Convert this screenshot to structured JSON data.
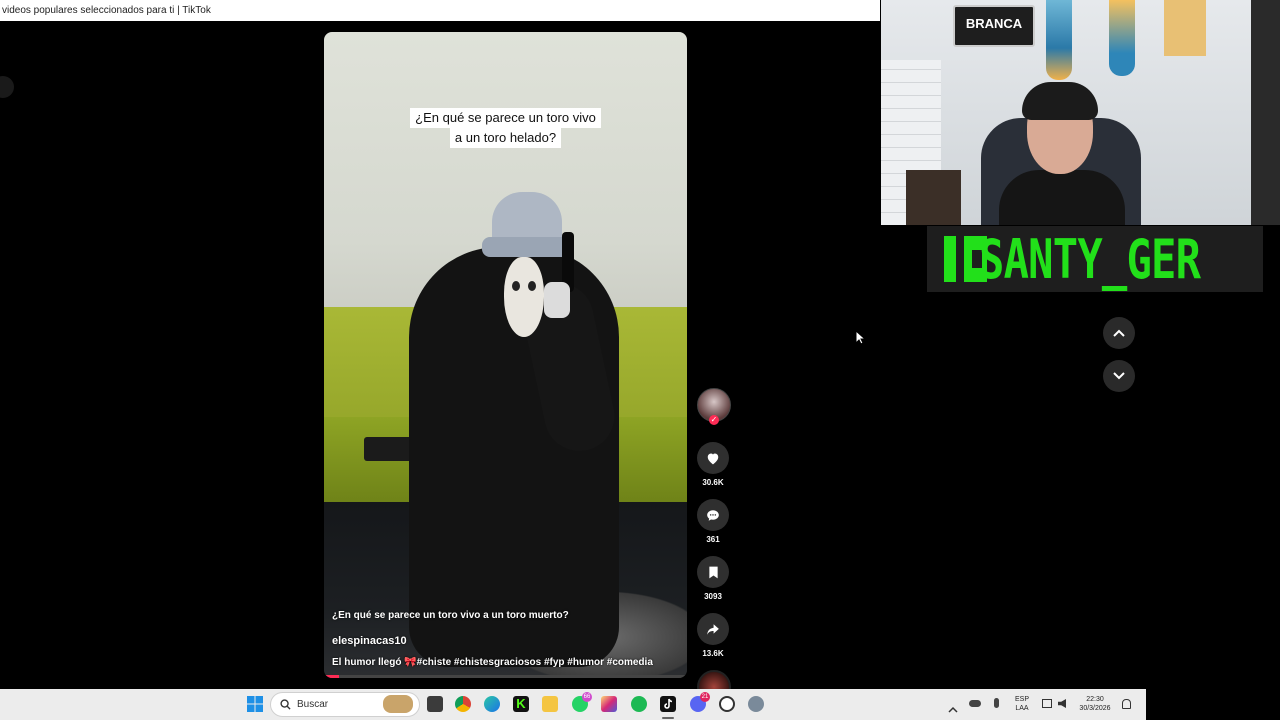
{
  "window": {
    "title": "videos populares seleccionados para ti | TikTok"
  },
  "video": {
    "overlay_caption_line1": "¿En qué se parece un toro vivo",
    "overlay_caption_line2": "a un toro helado?",
    "title": "¿En qué se parece un toro vivo a un toro muerto?",
    "author": "elespinacas10",
    "description": "El humor llegó 🎀#chiste #chistesgraciosos #fyp #humor #comedia",
    "progress_percent": 4
  },
  "actions": {
    "likes": "30.6K",
    "comments": "361",
    "saves": "3093",
    "shares": "13.6K"
  },
  "overlay": {
    "brand_name": "SANTY_GER",
    "sign_text": "BRANCA"
  },
  "taskbar": {
    "search_placeholder": "Buscar",
    "lang_line1": "ESP",
    "lang_line2": "LAA",
    "time": "22:30",
    "date": "30/3/2026",
    "badges": {
      "whatsapp": "66",
      "discord": "21"
    },
    "apps": [
      "start",
      "search",
      "widgets",
      "task-view",
      "chrome",
      "edge",
      "kick",
      "file-explorer",
      "whatsapp",
      "instagram",
      "spotify",
      "tiktok",
      "discord",
      "obs",
      "settings"
    ]
  },
  "colors": {
    "accent": "#fe2c55",
    "brand_green": "#22e01a",
    "taskbar_bg": "#ececec"
  }
}
